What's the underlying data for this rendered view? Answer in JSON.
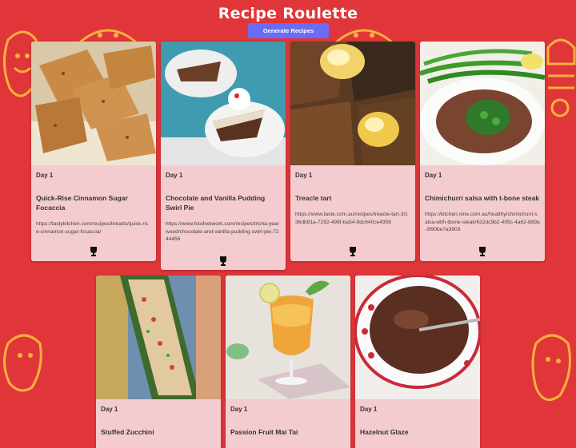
{
  "header": {
    "title": "Recipe Roulette",
    "generate_label": "Generate Recipes"
  },
  "colors": {
    "background": "#e0363a",
    "card": "#f4cccf",
    "button": "#6a6cf5",
    "doodle": "#f5b23a"
  },
  "recipes": [
    {
      "day": "Day 1",
      "name": "Quick-Rise Cinnamon Sugar Focaccia",
      "url": "https://tastykitchen.com/recipes/breads/quick-rise-cinnamon-sugar-focaccia/",
      "icon": "trophy-icon"
    },
    {
      "day": "Day 1",
      "name": "Chocolate and Vanilla Pudding Swirl Pie",
      "url": "https://www.foodnetwork.com/recipes/trisha-yearwood/chocolate-and-vanilla-pudding-swirl-pie-7244456",
      "icon": "trophy-icon"
    },
    {
      "day": "Day 1",
      "name": "Treacle tart",
      "url": "https://www.taste.com.au/recipes/treacle-tart-3/c36db91a-7292-498f-ba54-9dc640ce4398",
      "icon": "trophy-icon"
    },
    {
      "day": "Day 1",
      "name": "Chimichurri salsa with t-bone steak",
      "url": "https://kitchen.nine.com.au/healthy/chimichurri-salsa-with-tbone-steak/632dc9b2-405c-4a62-889a-3f90be7a3903",
      "icon": "trophy-icon"
    },
    {
      "day": "Day 1",
      "name": "Stuffed Zucchini"
    },
    {
      "day": "Day 1",
      "name": "Passion Fruit Mai Tai"
    },
    {
      "day": "Day 1",
      "name": "Hazelnut Glaze"
    }
  ]
}
